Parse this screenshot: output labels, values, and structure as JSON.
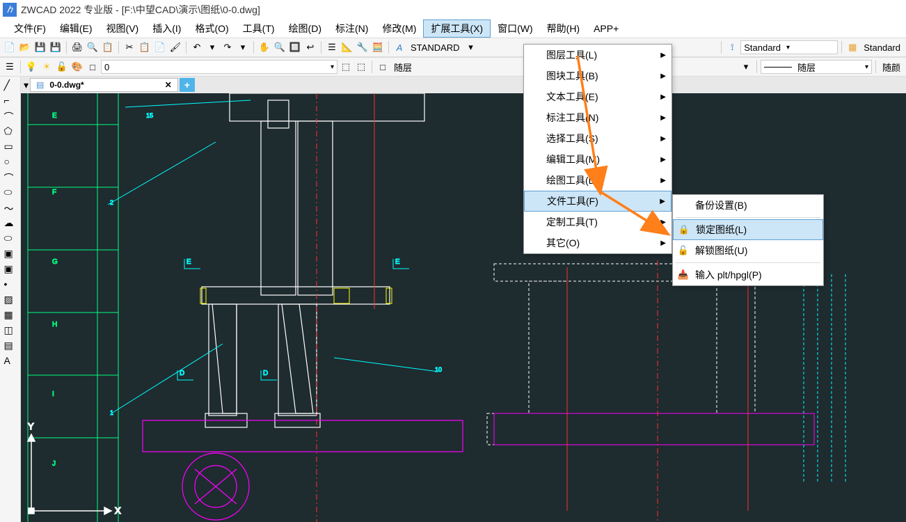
{
  "title": "ZWCAD 2022 专业版 - [F:\\中望CAD\\演示\\图纸\\0-0.dwg]",
  "menubar": {
    "file": "文件(F)",
    "edit": "编辑(E)",
    "view": "视图(V)",
    "insert": "插入(I)",
    "format": "格式(O)",
    "tools": "工具(T)",
    "draw": "绘图(D)",
    "dim": "标注(N)",
    "modify": "修改(M)",
    "ext": "扩展工具(X)",
    "window": "窗口(W)",
    "help": "帮助(H)",
    "app": "APP+"
  },
  "toolbar1": {
    "standard_label": "STANDARD",
    "style_standard1": "Standard",
    "style_standard2": "Standard"
  },
  "toolbar2": {
    "layer_value": "0",
    "bylayer": "随层",
    "suiceng2": "随层",
    "suiyan": "随颜"
  },
  "doc": {
    "tab_name": "0-0.dwg*",
    "close": "✕",
    "add": "+"
  },
  "ext_menu": {
    "layer_tools": "图层工具(L)",
    "block_tools": "图块工具(B)",
    "text_tools": "文本工具(E)",
    "dim_tools": "标注工具(N)",
    "select_tools": "选择工具(S)",
    "edit_tools": "编辑工具(M)",
    "draw_tools": "绘图工具(D)",
    "file_tools": "文件工具(F)",
    "custom_tools": "定制工具(T)",
    "other": "其它(O)"
  },
  "file_submenu": {
    "backup_settings": "备份设置(B)",
    "lock_drawing": "锁定图纸(L)",
    "unlock_drawing": "解锁图纸(U)",
    "import_plt": "输入 plt/hpgl(P)"
  },
  "canvas_labels": {
    "x": "X",
    "y": "Y"
  }
}
